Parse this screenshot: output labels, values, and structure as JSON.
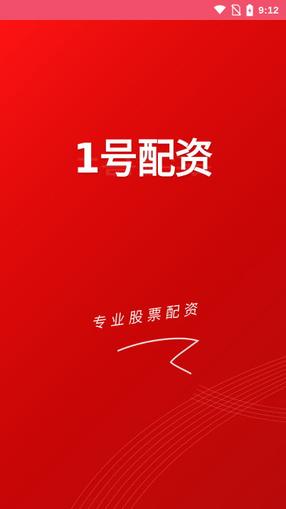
{
  "status_bar": {
    "time": "9:12",
    "icons": [
      "wifi-icon",
      "no-sim-icon",
      "battery-charging-icon"
    ]
  },
  "brand": {
    "title": "1号配资",
    "slogan": "专业股票配资"
  },
  "colors": {
    "status_bar": "#f2506a",
    "background_top": "#ff1414",
    "background_bottom": "#b80a0a",
    "text": "#ffffff"
  }
}
